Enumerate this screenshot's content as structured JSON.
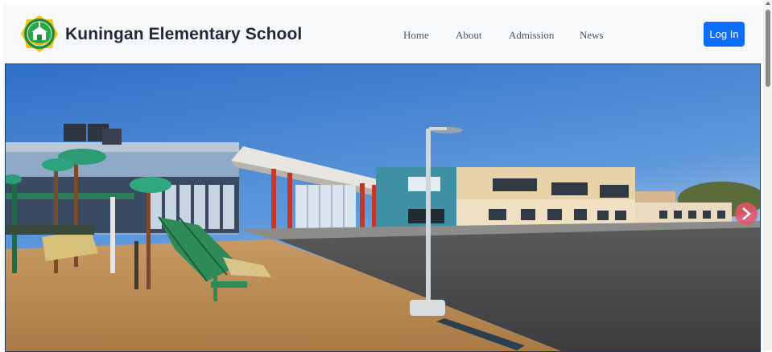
{
  "header": {
    "school_name": "Kuningan Elementary School",
    "logo_icon": "school-crest-emblem",
    "nav_items": [
      {
        "label": "Home"
      },
      {
        "label": "About"
      },
      {
        "label": "Admission"
      },
      {
        "label": "News"
      }
    ],
    "login_label": "Log In"
  },
  "hero": {
    "image_icon": "school-building-photo",
    "next_control_icon": "chevron-right-icon"
  },
  "colors": {
    "navbar_bg": "#f8f9fa",
    "brand_text": "#1f2937",
    "login_button": "#0d6efd",
    "logo_green": "#1e8c3a",
    "logo_yellow": "#f2c318"
  }
}
